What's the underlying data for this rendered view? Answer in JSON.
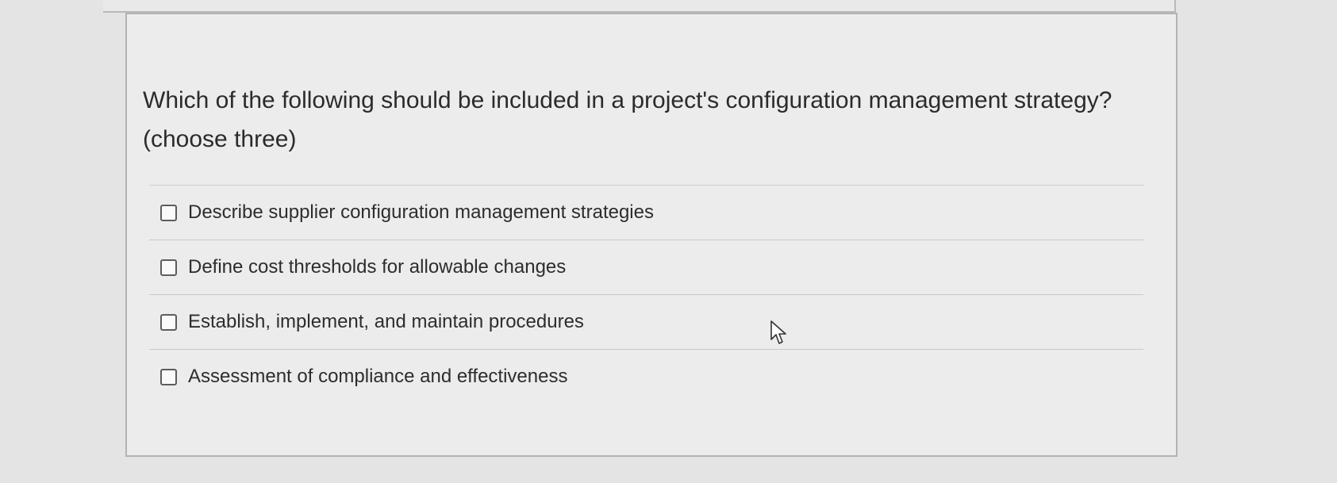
{
  "question": {
    "text": "Which of the following should be included in a project's configuration management strategy?",
    "instruction": "(choose three)"
  },
  "options": [
    {
      "label": "Describe supplier configuration management strategies",
      "checked": false
    },
    {
      "label": "Define cost thresholds for allowable changes",
      "checked": false
    },
    {
      "label": "Establish, implement, and maintain procedures",
      "checked": false
    },
    {
      "label": "Assessment of compliance and effectiveness",
      "checked": false
    }
  ],
  "cursor": {
    "icon": "mouse-pointer-icon"
  },
  "colors": {
    "background": "#e4e4e4",
    "card": "#ececec",
    "text": "#2b2b2b",
    "border": "#b3b3b3"
  }
}
